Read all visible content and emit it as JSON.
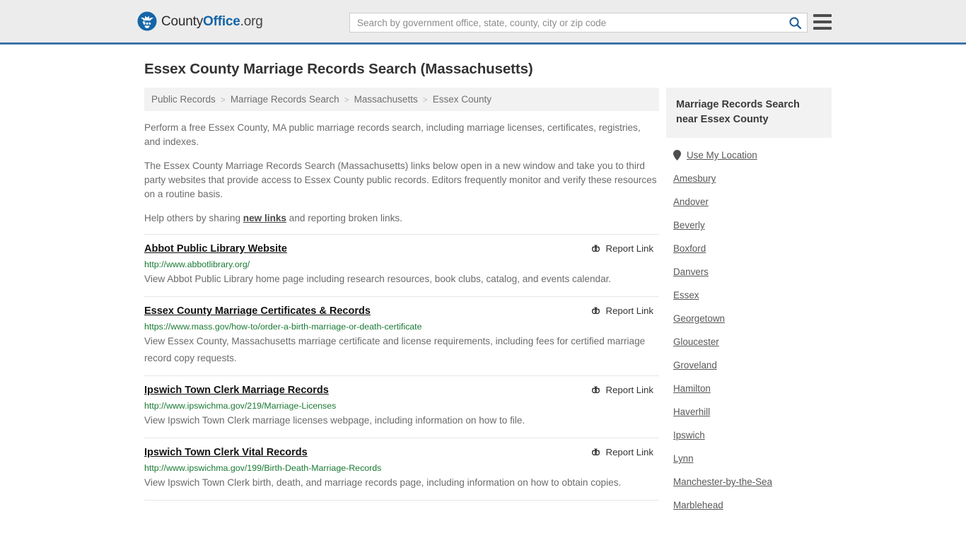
{
  "header": {
    "logo": {
      "emblem_icon": "eagle-seal-icon",
      "text_part1": "County",
      "text_part2": "Office",
      "text_part3": ".org"
    },
    "search": {
      "placeholder": "Search by government office, state, county, city or zip code",
      "value": "",
      "search_icon": "search-icon"
    },
    "menu_icon": "hamburger-menu-icon",
    "background_color": "#ececec",
    "accent_border_color": "#3c74a8"
  },
  "page_title": "Essex County Marriage Records Search (Massachusetts)",
  "breadcrumb": {
    "separator": ">",
    "items": [
      {
        "label": "Public Records"
      },
      {
        "label": "Marriage Records Search"
      },
      {
        "label": "Massachusetts"
      },
      {
        "label": "Essex County"
      }
    ]
  },
  "intro": {
    "paragraph1": "Perform a free Essex County, MA public marriage records search, including marriage licenses, certificates, registries, and indexes.",
    "paragraph2": "The Essex County Marriage Records Search (Massachusetts) links below open in a new window and take you to third party websites that provide access to Essex County public records. Editors frequently monitor and verify these resources on a routine basis.",
    "paragraph3_before": "Help others by sharing ",
    "paragraph3_link": "new links",
    "paragraph3_after": " and reporting broken links."
  },
  "report_link": {
    "label": "Report Link",
    "icon": "broken-link-icon"
  },
  "results": [
    {
      "title": "Abbot Public Library Website",
      "url": "http://www.abbotlibrary.org/",
      "description": "View Abbot Public Library home page including research resources, book clubs, catalog, and events calendar."
    },
    {
      "title": "Essex County Marriage Certificates & Records",
      "url": "https://www.mass.gov/how-to/order-a-birth-marriage-or-death-certificate",
      "description": "View Essex County, Massachusetts marriage certificate and license requirements, including fees for certified marriage record copy requests."
    },
    {
      "title": "Ipswich Town Clerk Marriage Records",
      "url": "http://www.ipswichma.gov/219/Marriage-Licenses",
      "description": "View Ipswich Town Clerk marriage licenses webpage, including information on how to file."
    },
    {
      "title": "Ipswich Town Clerk Vital Records",
      "url": "http://www.ipswichma.gov/199/Birth-Death-Marriage-Records",
      "description": "View Ipswich Town Clerk birth, death, and marriage records page, including information on how to obtain copies."
    }
  ],
  "sidebar": {
    "title": "Marriage Records Search near Essex County",
    "use_my_location": {
      "label": "Use My Location",
      "icon": "map-pin-icon"
    },
    "places": [
      {
        "label": "Amesbury"
      },
      {
        "label": "Andover"
      },
      {
        "label": "Beverly"
      },
      {
        "label": "Boxford"
      },
      {
        "label": "Danvers"
      },
      {
        "label": "Essex"
      },
      {
        "label": "Georgetown"
      },
      {
        "label": "Gloucester"
      },
      {
        "label": "Groveland"
      },
      {
        "label": "Hamilton"
      },
      {
        "label": "Haverhill"
      },
      {
        "label": "Ipswich"
      },
      {
        "label": "Lynn"
      },
      {
        "label": "Manchester-by-the-Sea"
      },
      {
        "label": "Marblehead"
      }
    ]
  },
  "colors": {
    "link_green": "#1a7a33",
    "brand_blue": "#1565a8",
    "body_text": "#6b6b6b",
    "panel_gray": "#f2f2f2"
  }
}
